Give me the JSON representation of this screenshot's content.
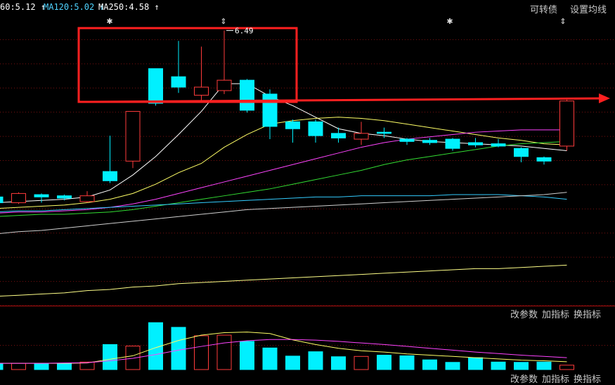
{
  "toolbar": {
    "ma_items": [
      {
        "label": "60:5.12",
        "arrow": "↑",
        "color": "#ffffff"
      },
      {
        "label": "MA120:5.02",
        "arrow": "↓",
        "color": "#4fd3ff"
      },
      {
        "label": "MA250:4.58",
        "arrow": "↑",
        "color": "#ffffff"
      }
    ],
    "convertible_bond_label": "可转债",
    "ma_settings_label": "设置均线"
  },
  "volume_toolbar": {
    "change_params_label": "改参数",
    "add_indicator_label": "加指标",
    "switch_indicator_label": "换指标"
  },
  "bottom_clipped_labels": [
    "改参数",
    "加指标",
    "换指标"
  ],
  "annotations": {
    "high_price_label": "6.49",
    "markers": [
      "✱",
      "⇕",
      "✱",
      "⇕"
    ]
  },
  "colors": {
    "up": "#ff3b3b",
    "down": "#00f0ff",
    "ma5": "#ffffff",
    "ma10": "#ffff66",
    "ma20": "#ff44ff",
    "ma30": "#33dd33",
    "ma60": "#33ccff",
    "ma120": "#cfcfcf",
    "ma250": "#ffff88",
    "highlight_box": "#ff2020",
    "arrow": "#ff2020"
  },
  "chart_data": {
    "type": "candlestick",
    "candles": [
      {
        "o": 5.05,
        "c": 5.0,
        "h": 5.06,
        "l": 4.98
      },
      {
        "o": 5.0,
        "c": 5.08,
        "h": 5.09,
        "l": 4.99
      },
      {
        "o": 5.07,
        "c": 5.05,
        "h": 5.08,
        "l": 5.0
      },
      {
        "o": 5.06,
        "c": 5.04,
        "h": 5.07,
        "l": 5.02
      },
      {
        "o": 5.01,
        "c": 5.06,
        "h": 5.1,
        "l": 5.0
      },
      {
        "o": 5.27,
        "c": 5.19,
        "h": 5.58,
        "l": 5.17
      },
      {
        "o": 5.36,
        "c": 5.79,
        "h": 5.79,
        "l": 5.3
      },
      {
        "o": 6.16,
        "c": 5.86,
        "h": 6.16,
        "l": 5.84
      },
      {
        "o": 6.09,
        "c": 6.0,
        "h": 6.4,
        "l": 5.95
      },
      {
        "o": 5.93,
        "c": 6.0,
        "h": 6.35,
        "l": 5.88
      },
      {
        "o": 5.97,
        "c": 6.06,
        "h": 6.49,
        "l": 5.94
      },
      {
        "o": 6.06,
        "c": 5.8,
        "h": 6.07,
        "l": 5.78
      },
      {
        "o": 5.94,
        "c": 5.66,
        "h": 5.98,
        "l": 5.55
      },
      {
        "o": 5.7,
        "c": 5.64,
        "h": 5.72,
        "l": 5.52
      },
      {
        "o": 5.7,
        "c": 5.58,
        "h": 5.72,
        "l": 5.52
      },
      {
        "o": 5.6,
        "c": 5.56,
        "h": 5.65,
        "l": 5.52
      },
      {
        "o": 5.55,
        "c": 5.6,
        "h": 5.7,
        "l": 5.5
      },
      {
        "o": 5.61,
        "c": 5.6,
        "h": 5.65,
        "l": 5.56
      },
      {
        "o": 5.55,
        "c": 5.53,
        "h": 5.56,
        "l": 5.5
      },
      {
        "o": 5.54,
        "c": 5.52,
        "h": 5.56,
        "l": 5.5
      },
      {
        "o": 5.55,
        "c": 5.47,
        "h": 5.56,
        "l": 5.45
      },
      {
        "o": 5.52,
        "c": 5.5,
        "h": 5.56,
        "l": 5.48
      },
      {
        "o": 5.51,
        "c": 5.49,
        "h": 5.55,
        "l": 5.48
      },
      {
        "o": 5.47,
        "c": 5.4,
        "h": 5.48,
        "l": 5.35
      },
      {
        "o": 5.39,
        "c": 5.36,
        "h": 5.4,
        "l": 5.33
      },
      {
        "o": 5.49,
        "c": 5.88,
        "h": 5.89,
        "l": 5.45
      }
    ],
    "ma_lines": [
      {
        "name": "MA5",
        "color": "#ffffff",
        "values": [
          5.0,
          5.01,
          5.02,
          5.03,
          5.05,
          5.11,
          5.24,
          5.4,
          5.59,
          5.79,
          6.03,
          6.03,
          5.92,
          5.84,
          5.74,
          5.64,
          5.6,
          5.58,
          5.55,
          5.53,
          5.52,
          5.51,
          5.5,
          5.49,
          5.47,
          5.45
        ]
      },
      {
        "name": "MA10",
        "color": "#ffff66",
        "values": [
          4.95,
          4.96,
          4.97,
          4.98,
          5.0,
          5.03,
          5.08,
          5.16,
          5.26,
          5.34,
          5.48,
          5.59,
          5.68,
          5.71,
          5.73,
          5.74,
          5.73,
          5.71,
          5.68,
          5.65,
          5.62,
          5.59,
          5.56,
          5.54,
          5.51,
          5.5
        ]
      },
      {
        "name": "MA20",
        "color": "#ff44ff",
        "values": [
          4.91,
          4.92,
          4.92,
          4.93,
          4.94,
          4.96,
          4.99,
          5.03,
          5.08,
          5.13,
          5.18,
          5.23,
          5.28,
          5.33,
          5.38,
          5.43,
          5.48,
          5.52,
          5.55,
          5.57,
          5.59,
          5.61,
          5.62,
          5.63,
          5.63,
          5.63
        ]
      },
      {
        "name": "MA30",
        "color": "#33dd33",
        "values": [
          4.88,
          4.89,
          4.9,
          4.9,
          4.91,
          4.92,
          4.94,
          4.97,
          5.0,
          5.03,
          5.06,
          5.09,
          5.12,
          5.16,
          5.2,
          5.24,
          5.28,
          5.33,
          5.37,
          5.4,
          5.43,
          5.46,
          5.49,
          5.51,
          5.52,
          5.53
        ]
      },
      {
        "name": "MA60",
        "color": "#33ccff",
        "values": [
          4.92,
          4.93,
          4.93,
          4.94,
          4.95,
          4.96,
          4.97,
          4.98,
          4.99,
          5.0,
          5.01,
          5.02,
          5.03,
          5.04,
          5.05,
          5.05,
          5.06,
          5.06,
          5.06,
          5.06,
          5.07,
          5.07,
          5.07,
          5.06,
          5.05,
          5.03
        ]
      },
      {
        "name": "MA120",
        "color": "#cfcfcf",
        "values": [
          4.73,
          4.75,
          4.76,
          4.78,
          4.8,
          4.82,
          4.84,
          4.86,
          4.88,
          4.9,
          4.92,
          4.94,
          4.95,
          4.96,
          4.97,
          4.98,
          4.99,
          5.0,
          5.01,
          5.02,
          5.03,
          5.04,
          5.05,
          5.06,
          5.07,
          5.09
        ]
      },
      {
        "name": "MA250",
        "color": "#ffff88",
        "values": [
          4.19,
          4.2,
          4.21,
          4.22,
          4.24,
          4.25,
          4.27,
          4.28,
          4.3,
          4.31,
          4.32,
          4.33,
          4.34,
          4.35,
          4.36,
          4.37,
          4.38,
          4.39,
          4.4,
          4.41,
          4.42,
          4.43,
          4.43,
          4.44,
          4.45,
          4.46
        ]
      }
    ],
    "volume": {
      "values": [
        20,
        20,
        20,
        20,
        24,
        80,
        75,
        150,
        135,
        108,
        110,
        90,
        69,
        43,
        57,
        41,
        42,
        46,
        44,
        31,
        23,
        38,
        24,
        23,
        24,
        14
      ],
      "ma_lines": [
        {
          "name": "VOL-MA1",
          "color": "#ffff66",
          "values": [
            20,
            20,
            20,
            20,
            21,
            33,
            44,
            70,
            93,
            110,
            118,
            120,
            115,
            95,
            80,
            68,
            60,
            56,
            50,
            46,
            42,
            38,
            34,
            30,
            28,
            25
          ]
        },
        {
          "name": "VOL-MA2",
          "color": "#ff44ff",
          "values": [
            20,
            20,
            20,
            21,
            22,
            28,
            36,
            48,
            62,
            74,
            85,
            92,
            96,
            96,
            94,
            90,
            85,
            80,
            74,
            68,
            62,
            56,
            51,
            46,
            42,
            38
          ]
        }
      ],
      "ylim": [
        0,
        155
      ]
    },
    "ylim": [
      4.11,
      6.62
    ]
  }
}
